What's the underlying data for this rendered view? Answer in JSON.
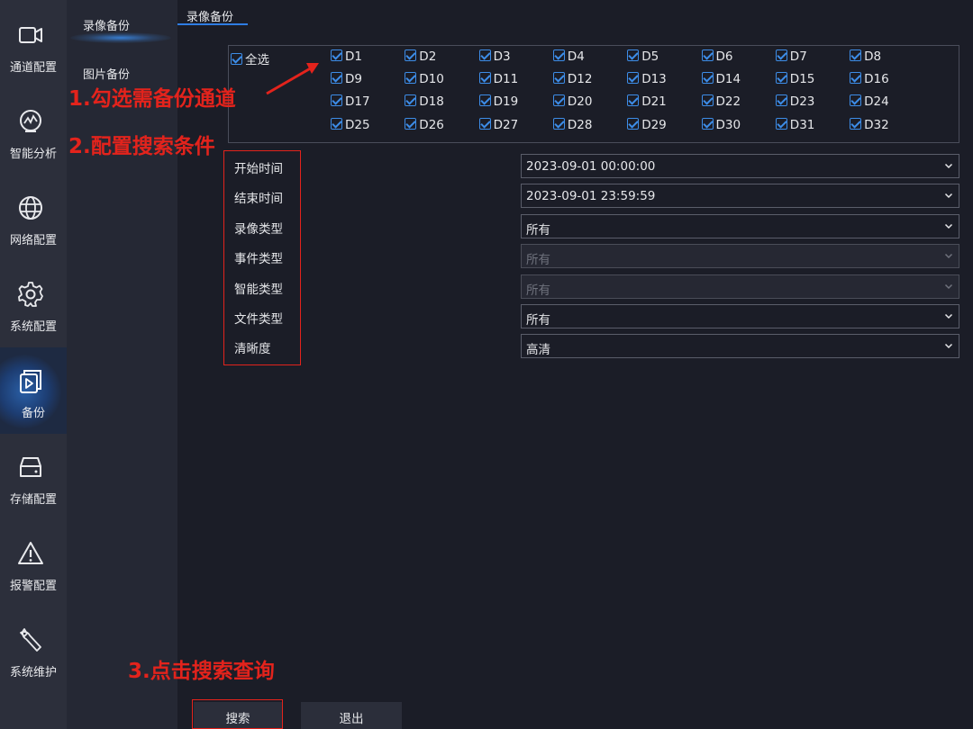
{
  "nav": {
    "items": [
      {
        "label": "通道配置",
        "icon": "camera-icon"
      },
      {
        "label": "智能分析",
        "icon": "analysis-icon"
      },
      {
        "label": "网络配置",
        "icon": "globe-icon"
      },
      {
        "label": "系统配置",
        "icon": "gear-icon"
      },
      {
        "label": "备份",
        "icon": "backup-icon"
      },
      {
        "label": "存储配置",
        "icon": "storage-icon"
      },
      {
        "label": "报警配置",
        "icon": "warning-icon"
      },
      {
        "label": "系统维护",
        "icon": "wrench-icon"
      }
    ],
    "active": "备份"
  },
  "submenu": {
    "video_backup": "录像备份",
    "picture_backup": "图片备份"
  },
  "tab": {
    "label": "录像备份"
  },
  "channels": {
    "select_all": "全选",
    "items": [
      "D1",
      "D2",
      "D3",
      "D4",
      "D5",
      "D6",
      "D7",
      "D8",
      "D9",
      "D10",
      "D11",
      "D12",
      "D13",
      "D14",
      "D15",
      "D16",
      "D17",
      "D18",
      "D19",
      "D20",
      "D21",
      "D22",
      "D23",
      "D24",
      "D25",
      "D26",
      "D27",
      "D28",
      "D29",
      "D30",
      "D31",
      "D32"
    ]
  },
  "form": {
    "fields": [
      {
        "label": "开始时间",
        "value": "2023-09-01 00:00:00",
        "disabled": false
      },
      {
        "label": "结束时间",
        "value": "2023-09-01 23:59:59",
        "disabled": false
      },
      {
        "label": "录像类型",
        "value": "所有",
        "disabled": false
      },
      {
        "label": "事件类型",
        "value": "所有",
        "disabled": true
      },
      {
        "label": "智能类型",
        "value": "所有",
        "disabled": true
      },
      {
        "label": "文件类型",
        "value": "所有",
        "disabled": false
      },
      {
        "label": "清晰度",
        "value": "高清",
        "disabled": false
      }
    ]
  },
  "buttons": {
    "search": "搜索",
    "exit": "退出"
  },
  "annotations": {
    "step1": "1.勾选需备份通道",
    "step2": "2.配置搜索条件",
    "step3": "3.点击搜索查询"
  },
  "colors": {
    "accent": "#2e7de3",
    "annotation": "#e3231c"
  }
}
